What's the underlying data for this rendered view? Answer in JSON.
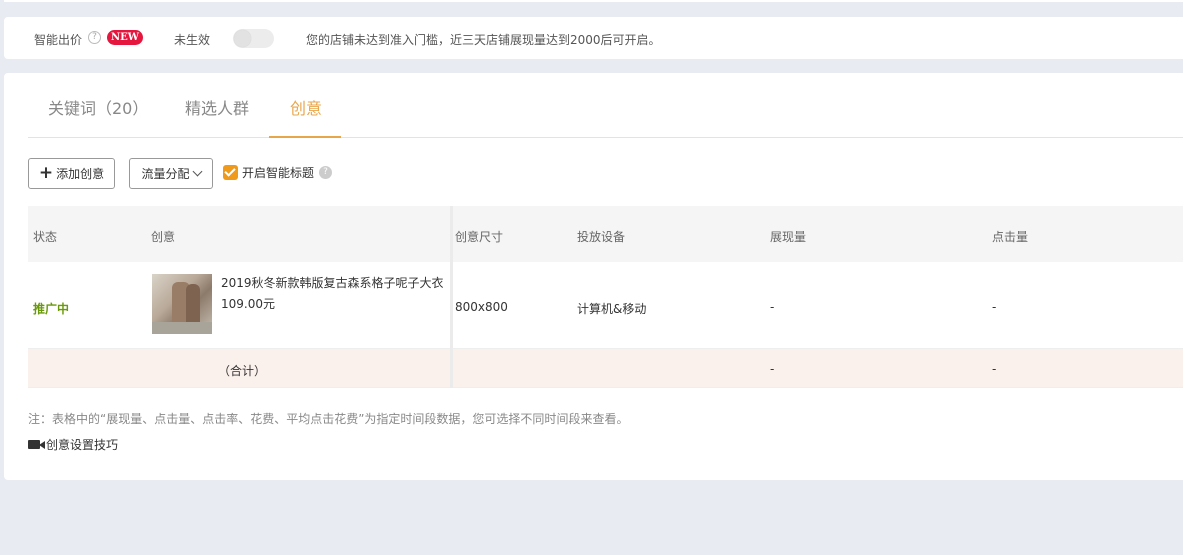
{
  "smart_bid": {
    "label": "智能出价",
    "help": "?",
    "badge": "NEW",
    "status": "未生效",
    "toggle_on": false,
    "notice": "您的店铺未达到准入门槛，近三天店铺展现量达到2000后可开启。"
  },
  "tabs": [
    {
      "label": "关键词（20）",
      "active": false
    },
    {
      "label": "精选人群",
      "active": false
    },
    {
      "label": "创意",
      "active": true
    }
  ],
  "toolbar": {
    "add_label": "添加创意",
    "flow_label": "流量分配",
    "smart_title_label": "开启智能标题",
    "smart_title_checked": true,
    "help": "?"
  },
  "table": {
    "headers": [
      "状态",
      "创意",
      "创意尺寸",
      "投放设备",
      "展现量",
      "点击量"
    ],
    "rows": [
      {
        "status": "推广中",
        "name": "2019秋冬新款韩版复古森系格子呢子大衣",
        "price": "109.00元",
        "size": "800x800",
        "device": "计算机&移动",
        "impressions": "-",
        "clicks": "-"
      }
    ],
    "summary": {
      "label": "（合计）",
      "impressions": "-",
      "clicks": "-"
    }
  },
  "note": "注：表格中的“展现量、点击量、点击率、花费、平均点击花费”为指定时间段数据，您可选择不同时间段来查看。",
  "tip_label": "创意设置技巧",
  "colors": {
    "accent": "#e8a64b",
    "status_active": "#6a9a09",
    "badge": "#e5173e",
    "checkbox": "#f09a1c"
  }
}
